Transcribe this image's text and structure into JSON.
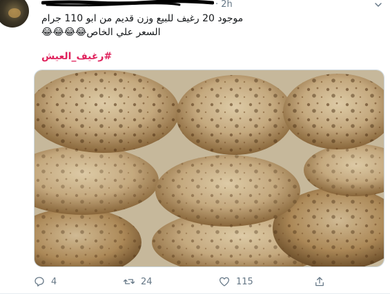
{
  "tweet": {
    "meta": "· 2h",
    "text_line1": "موجود 20 رغيف للبيع وزن قديم من ابو 110 جرام",
    "text_line2": "السعر علي الخاص😂😂😂😂",
    "hashtag": "#رغيف_العيش"
  },
  "actions": {
    "reply_count": "4",
    "retweet_count": "24",
    "like_count": "115"
  },
  "colors": {
    "hashtag": "#e0245e",
    "muted": "#657786"
  }
}
